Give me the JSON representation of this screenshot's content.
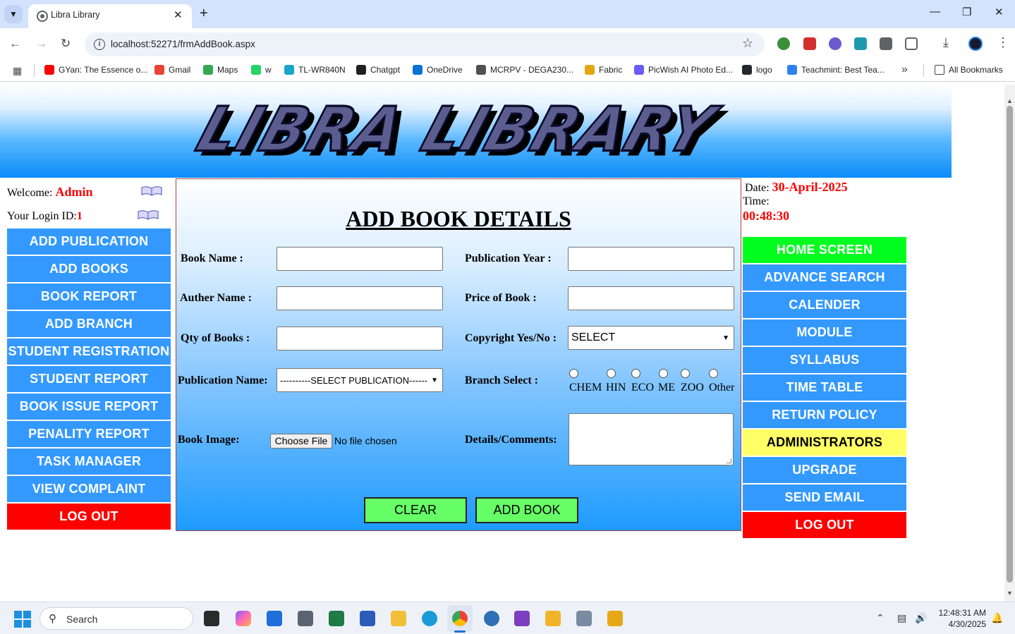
{
  "browser": {
    "tab_title": "Libra Library",
    "url": "localhost:52271/frmAddBook.aspx",
    "bookmarks": [
      {
        "label": "GYan: The Essence o...",
        "color": "#ff0000"
      },
      {
        "label": "Gmail",
        "color": "#ea4335"
      },
      {
        "label": "Maps",
        "color": "#34a853"
      },
      {
        "label": "w",
        "color": "#25d366"
      },
      {
        "label": "TL-WR840N",
        "color": "#1aa4c9"
      },
      {
        "label": "Chatgpt",
        "color": "#202020"
      },
      {
        "label": "OneDrive",
        "color": "#0a72d6"
      },
      {
        "label": "MCRPV - DEGA230...",
        "color": "#505050"
      },
      {
        "label": "Fabric",
        "color": "#e3a514"
      },
      {
        "label": "PicWish AI Photo Ed...",
        "color": "#6a5cf6"
      },
      {
        "label": "logo",
        "color": "#24292f"
      },
      {
        "label": "Teachmint: Best Tea...",
        "color": "#2f80ed"
      }
    ],
    "all_bookmarks": "All Bookmarks"
  },
  "header": {
    "logo_text": "LIBRA LIBRARY"
  },
  "user": {
    "welcome_label": "Welcome:",
    "user_name": "Admin",
    "login_id_label": "Your Login ID:",
    "login_id": "1"
  },
  "datetime": {
    "date_label": "Date:",
    "date": "30-April-2025",
    "time_label": "Time:",
    "time": "00:48:30"
  },
  "left_nav": [
    "ADD PUBLICATION",
    "ADD BOOKS",
    "BOOK REPORT",
    "ADD BRANCH",
    "STUDENT REGISTRATION",
    "STUDENT REPORT",
    "BOOK ISSUE REPORT",
    "PENALITY REPORT",
    "TASK MANAGER",
    "VIEW COMPLAINT",
    "LOG OUT"
  ],
  "right_nav": [
    "HOME SCREEN",
    "ADVANCE SEARCH",
    "CALENDER",
    "MODULE",
    "SYLLABUS",
    "TIME TABLE",
    "RETURN POLICY",
    "ADMINISTRATORS",
    "UPGRADE",
    "SEND EMAIL",
    "LOG OUT"
  ],
  "form": {
    "title": "ADD BOOK DETAILS",
    "book_name_label": "Book Name :",
    "book_name_value": "",
    "publication_year_label": "Publication Year :",
    "publication_year_value": "",
    "author_name_label": "Auther Name :",
    "author_name_value": "",
    "price_label": "Price of Book :",
    "price_value": "",
    "qty_label": "Qty of Books :",
    "qty_value": "",
    "copyright_label": "Copyright Yes/No :",
    "copyright_selected": "SELECT",
    "publication_name_label": "Publication Name:",
    "publication_selected": "----------SELECT PUBLICATION------",
    "branch_label": "Branch Select :",
    "branches": [
      "CHEM",
      "HIN",
      "ECO",
      "ME",
      "ZOO",
      "Other"
    ],
    "book_image_label": "Book Image:",
    "choose_file": "Choose File",
    "file_status": "No file chosen",
    "details_label": "Details/Comments:",
    "details_value": "",
    "clear_button": "CLEAR",
    "add_book_button": "ADD BOOK"
  },
  "taskbar": {
    "search_placeholder": "Search",
    "time": "12:48:31 AM",
    "date": "4/30/2025"
  },
  "colors": {
    "nav_blue": "#3399ff",
    "logout_red": "#ff0000",
    "home_green": "#00ff1e",
    "admin_yellow": "#ffff66",
    "action_green": "#66ff66"
  }
}
